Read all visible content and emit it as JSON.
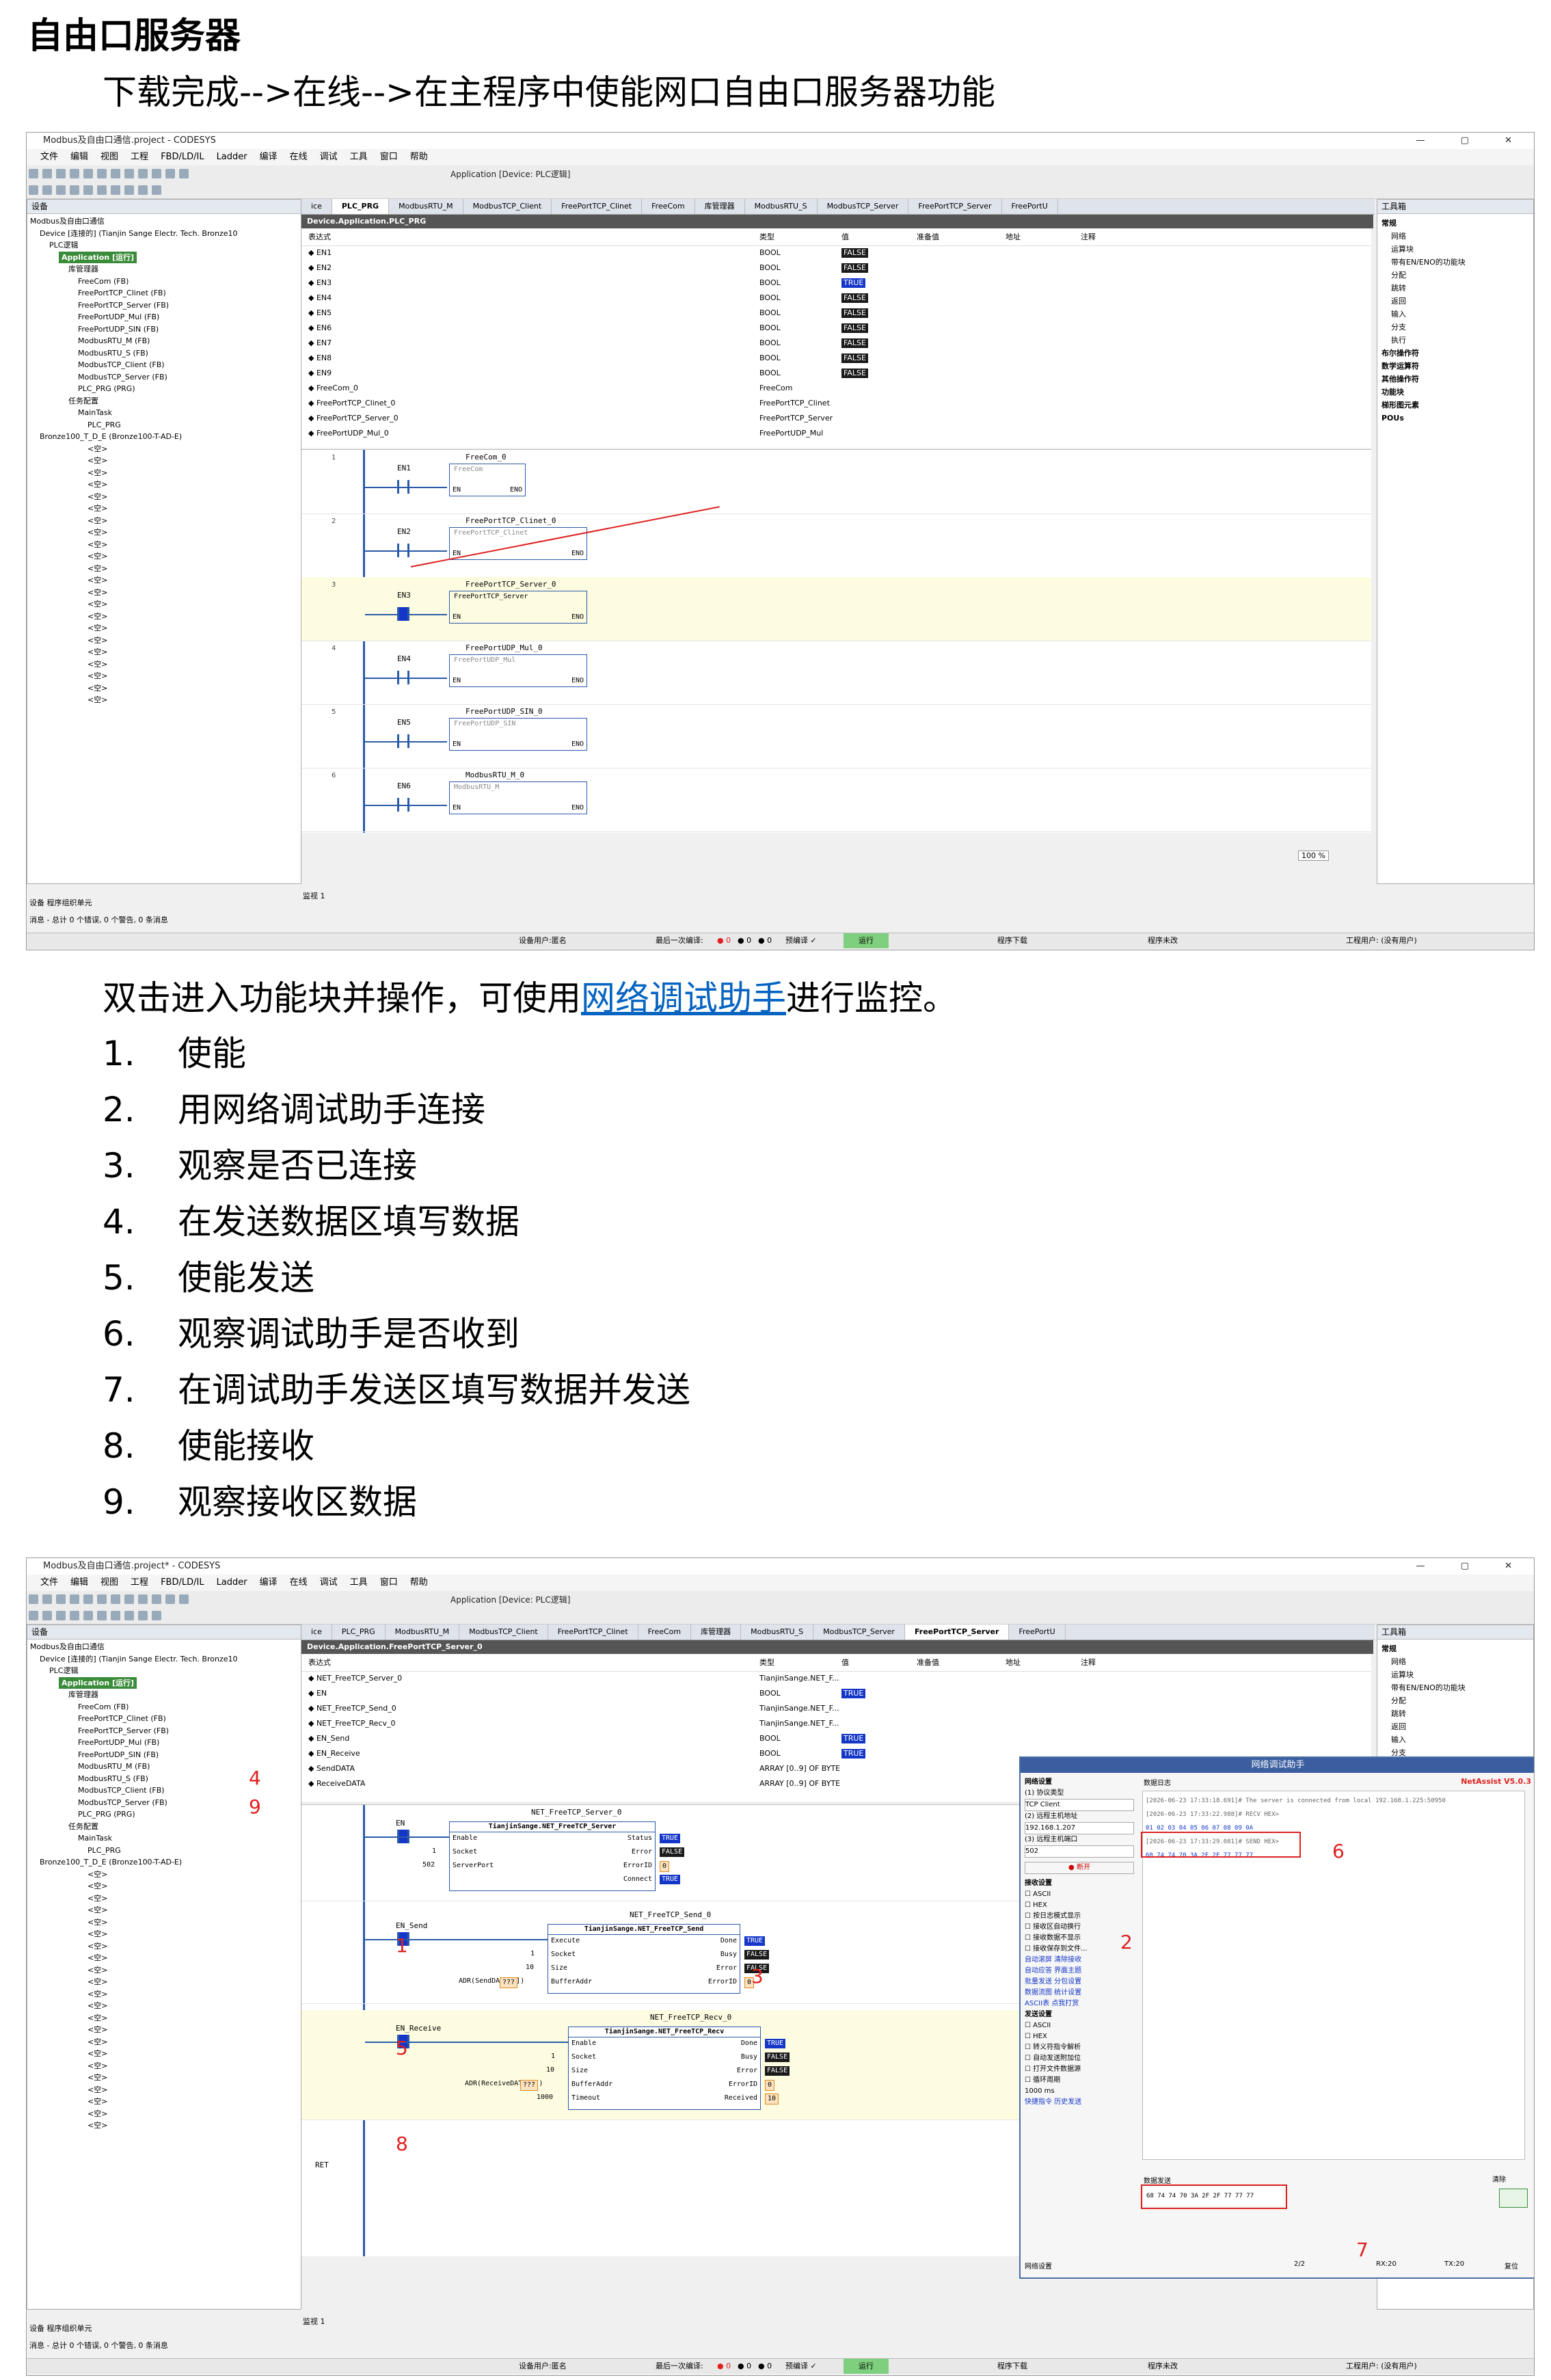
{
  "page": {
    "heading": "自由口服务器",
    "intro": "下载完成-->在线-->在主程序中使能网口自由口服务器功能",
    "para_prefix": "双击进入功能块并操作，可使用",
    "para_link": "网络调试助手",
    "para_suffix": "进行监控。",
    "steps": [
      {
        "num": "1.",
        "text": "使能"
      },
      {
        "num": "2.",
        "text": "用网络调试助手连接"
      },
      {
        "num": "3.",
        "text": "观察是否已连接"
      },
      {
        "num": "4.",
        "text": "在发送数据区填写数据"
      },
      {
        "num": "5.",
        "text": "使能发送"
      },
      {
        "num": "6.",
        "text": "观察调试助手是否收到"
      },
      {
        "num": "7.",
        "text": "在调试助手发送区填写数据并发送"
      },
      {
        "num": "8.",
        "text": "使能接收"
      },
      {
        "num": "9.",
        "text": "观察接收区数据"
      }
    ]
  },
  "ide1": {
    "title": "Modbus及自由口通信.project - CODESYS",
    "menu": [
      "文件",
      "编辑",
      "视图",
      "工程",
      "FBD/LD/IL",
      "Ladder",
      "编译",
      "在线",
      "调试",
      "工具",
      "窗口",
      "帮助"
    ],
    "toolbar_app": "Application [Device: PLC逻辑]",
    "devices_title": "设备",
    "tree": [
      "Modbus及自由口通信",
      "Device [连接的] (Tianjin Sange Electr. Tech. Bronze10",
      "PLC逻辑",
      "Application [运行]",
      "库管理器",
      "FreeCom (FB)",
      "FreePortTCP_Clinet (FB)",
      "FreePortTCP_Server (FB)",
      "FreePortUDP_Mul (FB)",
      "FreePortUDP_SIN (FB)",
      "ModbusRTU_M (FB)",
      "ModbusRTU_S (FB)",
      "ModbusTCP_Client (FB)",
      "ModbusTCP_Server (FB)",
      "PLC_PRG (PRG)",
      "任务配置",
      "MainTask",
      "PLC_PRG",
      "Bronze100_T_D_E (Bronze100-T-AD-E)"
    ],
    "slot": "<空>",
    "tabs": [
      "ice",
      "PLC_PRG",
      "ModbusRTU_M",
      "ModbusTCP_Client",
      "FreePortTCP_Clinet",
      "FreeCom",
      "库管理器",
      "ModbusRTU_S",
      "ModbusTCP_Server",
      "FreePortTCP_Server",
      "FreePortU"
    ],
    "crumb": "Device.Application.PLC_PRG",
    "cols": [
      "表达式",
      "类型",
      "值",
      "准备值",
      "地址",
      "注释"
    ],
    "rows": [
      {
        "e": "EN1",
        "t": "BOOL",
        "v": "FALSE"
      },
      {
        "e": "EN2",
        "t": "BOOL",
        "v": "FALSE"
      },
      {
        "e": "EN3",
        "t": "BOOL",
        "v": "TRUE"
      },
      {
        "e": "EN4",
        "t": "BOOL",
        "v": "FALSE"
      },
      {
        "e": "EN5",
        "t": "BOOL",
        "v": "FALSE"
      },
      {
        "e": "EN6",
        "t": "BOOL",
        "v": "FALSE"
      },
      {
        "e": "EN7",
        "t": "BOOL",
        "v": "FALSE"
      },
      {
        "e": "EN8",
        "t": "BOOL",
        "v": "FALSE"
      },
      {
        "e": "EN9",
        "t": "BOOL",
        "v": "FALSE"
      },
      {
        "e": "FreeCom_0",
        "t": "FreeCom",
        "v": ""
      },
      {
        "e": "FreePortTCP_Clinet_0",
        "t": "FreePortTCP_Clinet",
        "v": ""
      },
      {
        "e": "FreePortTCP_Server_0",
        "t": "FreePortTCP_Server",
        "v": ""
      },
      {
        "e": "FreePortUDP_Mul_0",
        "t": "FreePortUDP_Mul",
        "v": ""
      }
    ],
    "rungs": [
      {
        "n": "1",
        "contact": "EN1",
        "inst": "FreeCom_0",
        "fb": "FreeCom"
      },
      {
        "n": "2",
        "contact": "EN2",
        "inst": "FreePortTCP_Clinet_0",
        "fb": "FreePortTCP_Clinet"
      },
      {
        "n": "3",
        "contact": "EN3",
        "inst": "FreePortTCP_Server_0",
        "fb": "FreePortTCP_Server"
      },
      {
        "n": "4",
        "contact": "EN4",
        "inst": "FreePortUDP_Mul_0",
        "fb": "FreePortUDP_Mul"
      },
      {
        "n": "5",
        "contact": "EN5",
        "inst": "FreePortUDP_SIN_0",
        "fb": "FreePortUDP_SIN"
      },
      {
        "n": "6",
        "contact": "EN6",
        "inst": "ModbusRTU_M_0",
        "fb": "ModbusRTU_M"
      }
    ],
    "en": "EN",
    "eno": "ENO",
    "zoom": "100 %",
    "toolbox_title": "工具箱",
    "toolbox": [
      "常规",
      "网络",
      "运算块",
      "带有EN/ENO的功能块",
      "分配",
      "跳转",
      "返回",
      "输入",
      "分支",
      "执行",
      "布尔操作符",
      "数学运算符",
      "其他操作符",
      "功能块",
      "梯形图元素",
      "POUs"
    ],
    "monitor": "监视 1",
    "tabs_bottom": [
      "设备",
      "程序组织单元"
    ],
    "msg": "消息 - 总计 0 个错误, 0 个警告, 0 条消息",
    "status": {
      "user": "设备用户:匿名",
      "last": "最后一次编译:",
      "err": "0",
      "warn": "0",
      "msg": "0",
      "precompile": "预编译",
      "run": "运行",
      "download": "程序下载",
      "nochange": "程序未改",
      "project_user": "工程用户: (没有用户)"
    }
  },
  "ide2": {
    "title": "Modbus及自由口通信.project* - CODESYS",
    "crumb": "Device.Application.FreePortTCP_Server_0",
    "rows": [
      {
        "e": "NET_FreeTCP_Server_0",
        "t": "TianjinSange.NET_F...",
        "v": ""
      },
      {
        "e": "EN",
        "t": "BOOL",
        "v": "TRUE"
      },
      {
        "e": "NET_FreeTCP_Send_0",
        "t": "TianjinSange.NET_F...",
        "v": ""
      },
      {
        "e": "NET_FreeTCP_Recv_0",
        "t": "TianjinSange.NET_F...",
        "v": ""
      },
      {
        "e": "EN_Send",
        "t": "BOOL",
        "v": "TRUE"
      },
      {
        "e": "EN_Receive",
        "t": "BOOL",
        "v": "TRUE"
      },
      {
        "e": "SendDATA",
        "t": "ARRAY [0..9] OF BYTE",
        "v": ""
      },
      {
        "e": "ReceiveDATA",
        "t": "ARRAY [0..9] OF BYTE",
        "v": ""
      }
    ],
    "fb1": {
      "inst": "NET_FreeTCP_Server_0",
      "name": "TianjinSange.NET_FreeTCP_Server",
      "contact": "EN",
      "in": [
        "Enable",
        "Socket",
        "ServerPort"
      ],
      "inv": [
        "",
        "1",
        "502"
      ],
      "out": [
        "Status",
        "Error",
        "ErrorID",
        "Connect"
      ],
      "outv": [
        "TRUE",
        "FALSE",
        "0",
        "TRUE"
      ]
    },
    "fb2": {
      "inst": "NET_FreeTCP_Send_0",
      "name": "TianjinSange.NET_FreeTCP_Send",
      "contact": "EN_Send",
      "in": [
        "Execute",
        "Socket",
        "Size",
        "BufferAddr"
      ],
      "inv": [
        "",
        "1",
        "10",
        "ADR(SendDATA[0])"
      ],
      "out": [
        "Done",
        "Busy",
        "Error",
        "ErrorID"
      ],
      "outv": [
        "TRUE",
        "FALSE",
        "FALSE",
        "0"
      ],
      "addr": "???"
    },
    "fb3": {
      "inst": "NET_FreeTCP_Recv_0",
      "name": "TianjinSange.NET_FreeTCP_Recv",
      "contact": "EN_Receive",
      "in": [
        "Enable",
        "Socket",
        "Size",
        "BufferAddr",
        "Timeout"
      ],
      "inv": [
        "",
        "1",
        "10",
        "ADR(ReceiveDATA[0])",
        "1000"
      ],
      "out": [
        "Done",
        "Busy",
        "Error",
        "ErrorID",
        "Received"
      ],
      "outv": [
        "TRUE",
        "FALSE",
        "FALSE",
        "0",
        "10"
      ],
      "addr": "???"
    },
    "ret": "RET",
    "netassist": {
      "title": "网络调试助手",
      "version": "NetAssist V5.0.3",
      "net_settings": "网络设置",
      "proto_label": "(1) 协议类型",
      "proto": "TCP Client",
      "host_label": "(2) 远程主机地址",
      "host": "192.168.1.207",
      "port_label": "(3) 远程主机端口",
      "port": "502",
      "disconnect": "断开",
      "recv_settings": "接收设置",
      "recv_opts": [
        "ASCII",
        "HEX",
        "按日志模式显示",
        "接收区自动换行",
        "接收数据不显示",
        "接收保存到文件..."
      ],
      "auto_scroll": "自动滚屏",
      "clear_recv": "清除接收",
      "shortcuts": [
        "自动应答",
        "界面主题",
        "批量发送",
        "分包设置",
        "数据流图",
        "统计设置",
        "ASCII表",
        "点我打赏"
      ],
      "send_settings": "发送设置",
      "send_opts": [
        "ASCII",
        "HEX",
        "转义符指令解析",
        "自动发送附加位",
        "打开文件数据源",
        "循环周期"
      ],
      "cycle": "1000",
      "ms": "ms",
      "shortcut_links": [
        "快捷指令",
        "历史发送"
      ],
      "log_title": "数据日志",
      "log": [
        "[2026-06-23 17:33:18.691]# The server is connected from local 192.168.1.225:50950",
        "[2026-06-23 17:33:22.988]# RECV HEX>",
        "01 02 03 04 05 06 07 08 09 0A",
        "[2026-06-23 17:33:29.081]# SEND HEX>",
        "68 74 74 70 3A 2F 2F 77 77 77"
      ],
      "send_title": "数据发送",
      "clear": "清除",
      "send_data": "68 74 74 70 3A 2F 2F 77 77 77",
      "foot": "网络设置",
      "page": "2/2",
      "rx": "RX:20",
      "tx": "TX:20",
      "reset": "复位"
    },
    "annot": [
      "1",
      "2",
      "3",
      "4",
      "5",
      "6",
      "7",
      "8",
      "9"
    ]
  }
}
